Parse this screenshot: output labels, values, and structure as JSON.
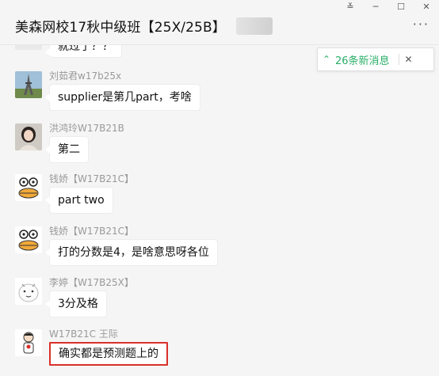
{
  "window": {
    "title": "美森网校17秋中级班【25X/25B】",
    "controls": [
      "≚",
      "─",
      "☐",
      "✕"
    ],
    "more": "···"
  },
  "notification": {
    "arrow": "⌃",
    "text": "26条新消息",
    "close": "✕"
  },
  "colors": {
    "accent": "#2aae67",
    "highlight": "#d9302a"
  },
  "messages": [
    {
      "name": "",
      "text": "就过了？？",
      "avatar": "partial-avatar"
    },
    {
      "name": "刘茹君w17b25x",
      "text": "supplier是第几part，考啥",
      "avatar": "eiffel-tower-avatar"
    },
    {
      "name": "洪鸿玲W17B21B",
      "text": "第二",
      "avatar": "woman-photo-avatar"
    },
    {
      "name": "钱娇【W17B21C】",
      "text": "part two",
      "avatar": "cartoon-duck-avatar"
    },
    {
      "name": "钱娇【W17B21C】",
      "text": "打的分数是4，是啥意思呀各位",
      "avatar": "cartoon-duck-avatar"
    },
    {
      "name": "李婷【W17B25X】",
      "text": "3分及格",
      "avatar": "cartoon-bun-avatar"
    },
    {
      "name": "W17B21C 王际",
      "text": "确实都是预测题上的",
      "avatar": "cartoon-man-avatar"
    }
  ]
}
